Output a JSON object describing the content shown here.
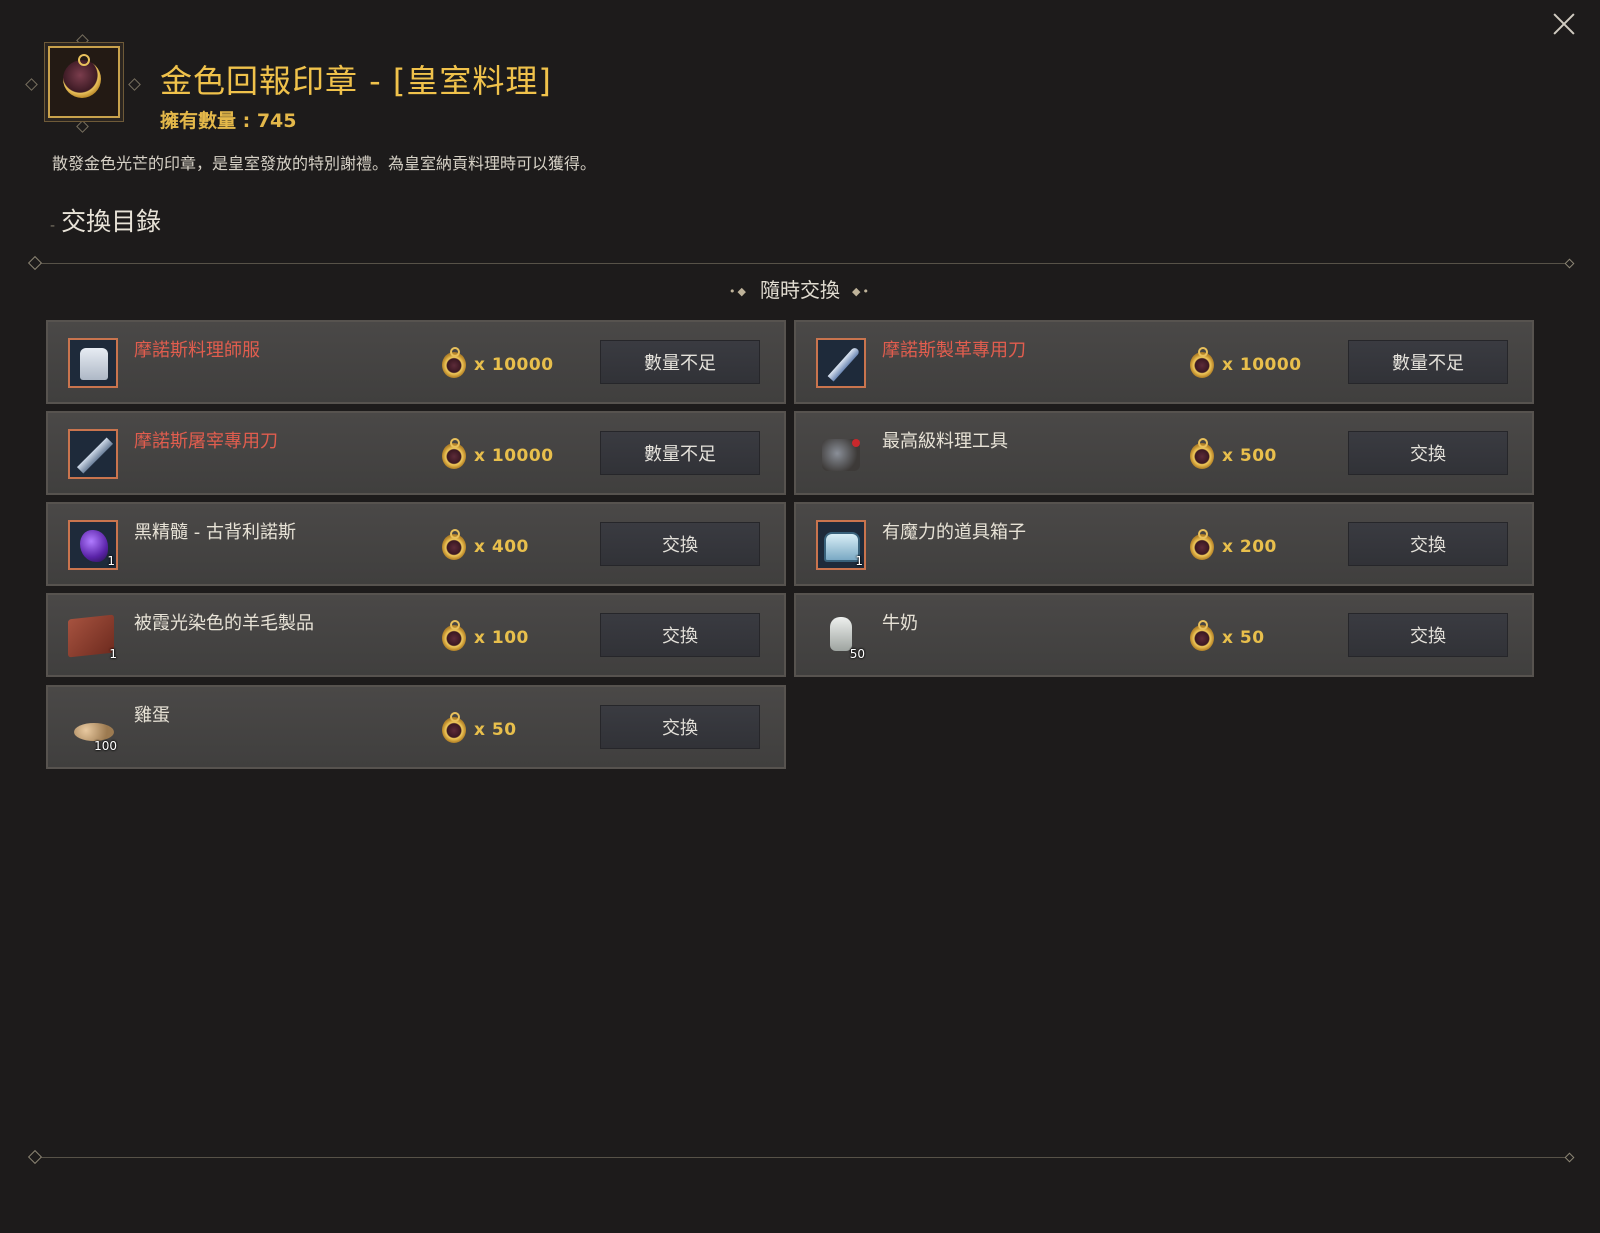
{
  "window": {
    "title": "金色回報印章 - [皇室料理]",
    "owned": "擁有數量 : 745",
    "description": "散發金色光芒的印章，是皇室發放的特別謝禮。為皇室納貢料理時可以獲得。",
    "section_title": "交換目錄",
    "subheader": "隨時交換"
  },
  "items": [
    {
      "name": "摩諾斯料理師服",
      "cost": "x 10000",
      "button": "數量不足",
      "name_color": "red",
      "icon": "chef-uniform-icon",
      "qty": ""
    },
    {
      "name": "摩諾斯製革專用刀",
      "cost": "x 10000",
      "button": "數量不足",
      "name_color": "red",
      "icon": "leather-knife-icon",
      "qty": ""
    },
    {
      "name": "摩諾斯屠宰專用刀",
      "cost": "x 10000",
      "button": "數量不足",
      "name_color": "red",
      "icon": "butcher-knife-icon",
      "qty": ""
    },
    {
      "name": "最高級料理工具",
      "cost": "x 500",
      "button": "交換",
      "name_color": "white",
      "icon": "cooking-tools-icon",
      "qty": ""
    },
    {
      "name": "黑精髓 - 古背利諾斯",
      "cost": "x 400",
      "button": "交換",
      "name_color": "white",
      "icon": "black-essence-icon",
      "qty": "1"
    },
    {
      "name": "有魔力的道具箱子",
      "cost": "x 200",
      "button": "交換",
      "name_color": "white",
      "icon": "magic-chest-icon",
      "qty": "1"
    },
    {
      "name": "被霞光染色的羊毛製品",
      "cost": "x 100",
      "button": "交換",
      "name_color": "white",
      "icon": "wool-product-icon",
      "qty": "1"
    },
    {
      "name": "牛奶",
      "cost": "x 50",
      "button": "交換",
      "name_color": "white",
      "icon": "milk-icon",
      "qty": "50"
    },
    {
      "name": "雞蛋",
      "cost": "x 50",
      "button": "交換",
      "name_color": "white",
      "icon": "egg-icon",
      "qty": "100"
    }
  ],
  "colors": {
    "background": "#1d1b1b",
    "title_gold": "#f0c24b",
    "unaffordable_red": "#e15d4e",
    "cost_gold": "#e8bf4c"
  }
}
